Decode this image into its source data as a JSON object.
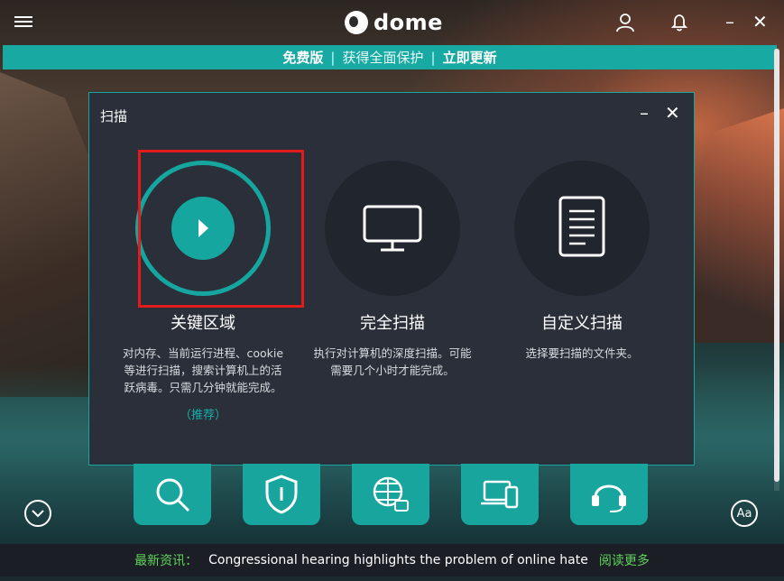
{
  "app": {
    "logo_text": "dome"
  },
  "promo": {
    "free": "免费版",
    "sep": "|",
    "text": "获得全面保护",
    "upgrade": "立即更新"
  },
  "modal": {
    "title": "扫描",
    "options": [
      {
        "title": "关键区域",
        "desc": "对内存、当前运行进程、cookie 等进行扫描，搜索计算机上的活跃病毒。只需几分钟就能完成。",
        "recommend": "（推荐）",
        "icon": "play-icon",
        "selected": true
      },
      {
        "title": "完全扫描",
        "desc": "执行对计算机的深度扫描。可能需要几个小时才能完成。",
        "icon": "monitor-icon"
      },
      {
        "title": "自定义扫描",
        "desc": "选择要扫描的文件夹。",
        "icon": "document-icon"
      }
    ]
  },
  "bottom_icons": [
    "search-icon",
    "shield-icon",
    "globe-lock-icon",
    "devices-icon",
    "support-icon"
  ],
  "buttons": {
    "font_size_label": "Aa"
  },
  "news": {
    "label": "最新资讯：",
    "headline": "Congressional hearing highlights the problem of online hate",
    "more": "阅读更多"
  },
  "colors": {
    "accent": "#16a6a0",
    "highlight": "#e21b1b",
    "news_label": "#5fd35a"
  }
}
